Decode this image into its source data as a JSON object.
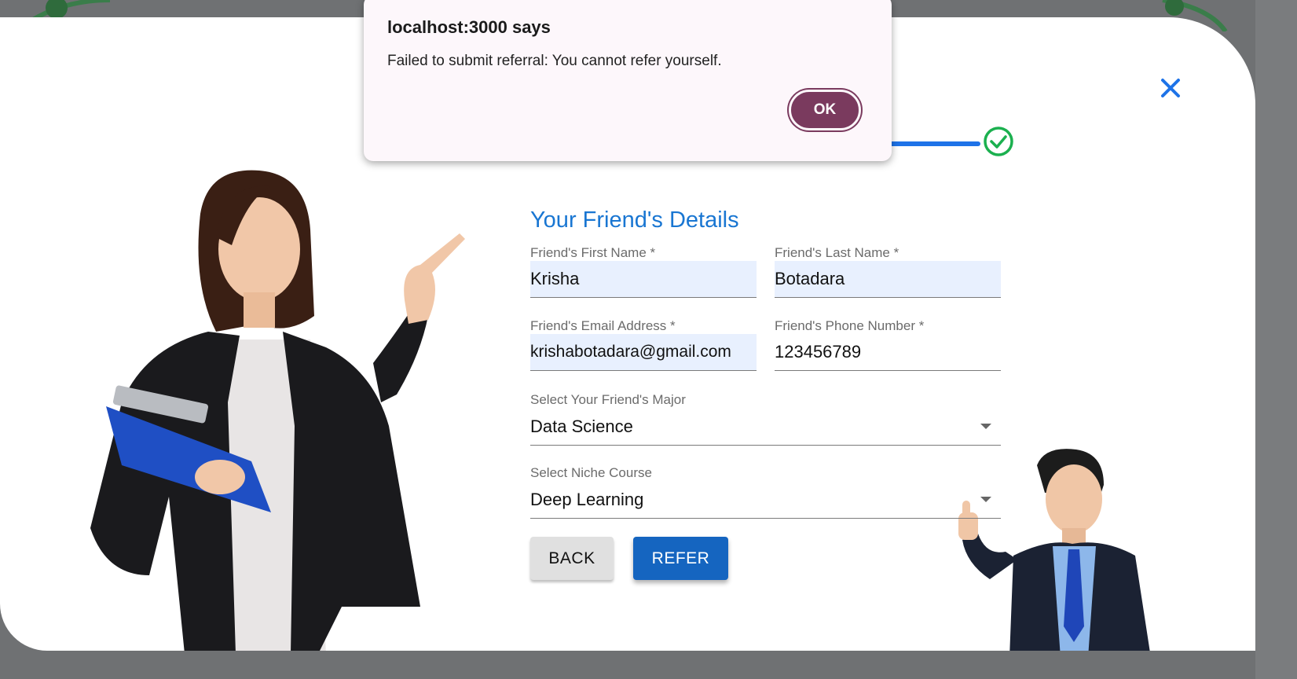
{
  "dialog": {
    "title": "localhost:3000 says",
    "message": "Failed to submit referral: You cannot refer yourself.",
    "ok_label": "OK"
  },
  "form": {
    "title": "Your Friend's Details",
    "first_name": {
      "label": "Friend's First Name *",
      "value": "Krisha"
    },
    "last_name": {
      "label": "Friend's Last Name *",
      "value": "Botadara"
    },
    "email": {
      "label": "Friend's Email Address *",
      "value": "krishabotadara@gmail.com"
    },
    "phone": {
      "label": "Friend's Phone Number *",
      "value": "123456789"
    },
    "major": {
      "label": "Select Your Friend's Major",
      "value": "Data Science"
    },
    "course": {
      "label": "Select Niche Course",
      "value": "Deep Learning"
    },
    "back_label": "BACK",
    "refer_label": "REFER"
  },
  "colors": {
    "accent": "#1976d2",
    "button_primary": "#1565c0",
    "dialog_ok": "#7a3a5e",
    "step_done": "#1bb04f",
    "input_fill": "#e8f0fe"
  },
  "icons": {
    "close": "close-icon",
    "step_complete": "check-circle-icon",
    "dropdown": "chevron-down-icon"
  }
}
